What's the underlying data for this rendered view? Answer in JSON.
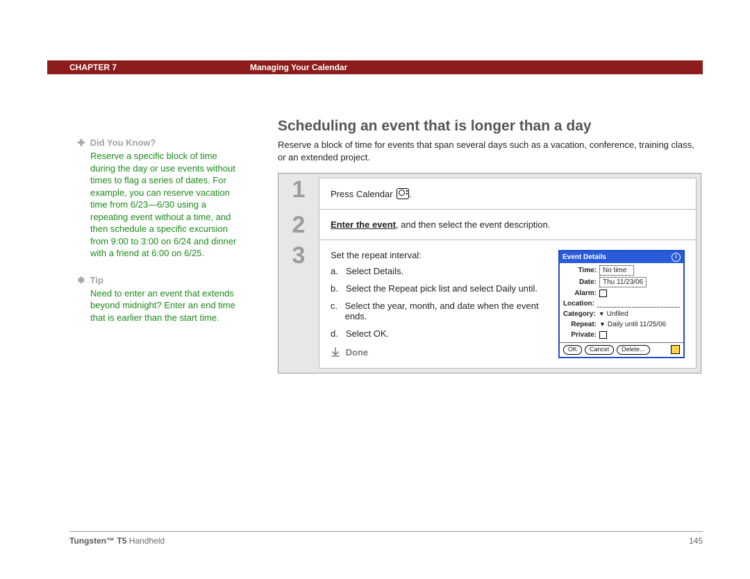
{
  "header": {
    "chapter": "CHAPTER 7",
    "title": "Managing Your Calendar"
  },
  "sidebar": {
    "dyk_label": "Did You Know?",
    "dyk_body": "Reserve a specific block of time during the day or use events without times to flag a series of dates. For example, you can reserve vacation time from 6/23—6/30 using a repeating event without a time, and then schedule a specific excursion from 9:00 to 3:00 on 6/24 and dinner with a friend at 6:00 on 6/25.",
    "tip_label": "Tip",
    "tip_body": "Need to enter an event that extends beyond midnight? Enter an end time that is earlier than the start time."
  },
  "main": {
    "heading": "Scheduling an event that is longer than a day",
    "intro": "Reserve a block of time for events that span several days such as a vacation, conference, training class, or an extended project.",
    "step1_pre": "Press Calendar ",
    "step1_post": ".",
    "step2_link": "Enter the event",
    "step2_rest": ", and then select the event description.",
    "step3_title": "Set the repeat interval:",
    "step3_a": "Select Details.",
    "step3_b": "Select the Repeat pick list and select Daily until.",
    "step3_c": "Select the year, month, and date when the event ends.",
    "step3_d": "Select OK.",
    "done": "Done"
  },
  "event_details": {
    "title": "Event Details",
    "time_label": "Time:",
    "time_val": "No time",
    "date_label": "Date:",
    "date_val": "Thu 11/23/06",
    "alarm_label": "Alarm:",
    "location_label": "Location:",
    "category_label": "Category:",
    "category_val": "Unfiled",
    "repeat_label": "Repeat:",
    "repeat_val": "Daily until 11/25/06",
    "private_label": "Private:",
    "btn_ok": "OK",
    "btn_cancel": "Cancel",
    "btn_delete": "Delete..."
  },
  "footer": {
    "product_bold": "Tungsten™ T5",
    "product_rest": " Handheld",
    "page": "145"
  }
}
